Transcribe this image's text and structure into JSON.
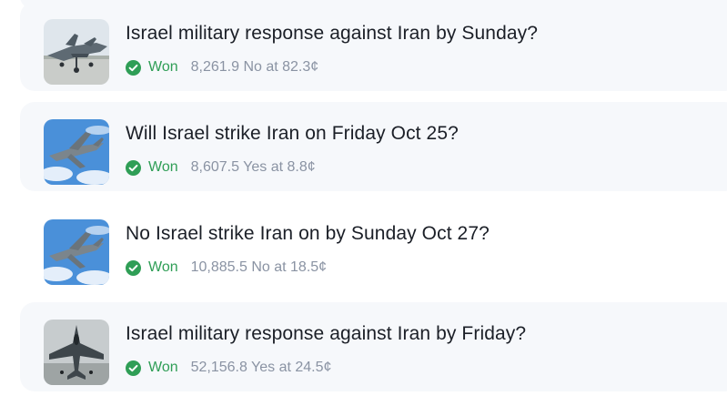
{
  "colors": {
    "card_bg": "#f6f8fb",
    "title": "#1b1f27",
    "won_green": "#2f9e56",
    "detail_gray": "#8a93a3"
  },
  "markets": [
    {
      "image_icon": "fighter-jet-on-runway",
      "title": "Israel military response against Iran by Sunday?",
      "status_icon": "check-circle-icon",
      "status": "Won",
      "detail": "8,261.9 No at 82.3¢"
    },
    {
      "image_icon": "fighter-jet-in-sky",
      "title": "Will Israel strike Iran on Friday Oct 25?",
      "status_icon": "check-circle-icon",
      "status": "Won",
      "detail": "8,607.5 Yes at 8.8¢"
    },
    {
      "image_icon": "fighter-jet-in-sky",
      "title": "No Israel strike Iran on by Sunday Oct 27?",
      "status_icon": "check-circle-icon",
      "status": "Won",
      "detail": "10,885.5 No at 18.5¢"
    },
    {
      "image_icon": "stealth-jet-on-ground",
      "title": "Israel military response against Iran by Friday?",
      "status_icon": "check-circle-icon",
      "status": "Won",
      "detail": "52,156.8 Yes at 24.5¢"
    }
  ]
}
